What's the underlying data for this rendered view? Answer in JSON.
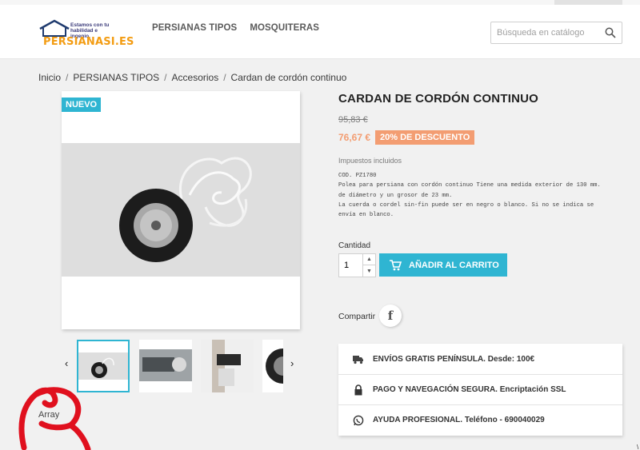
{
  "header": {
    "logo_tagline": "Estamos con tu habilidad e ingenio.",
    "logo_brand": "PERSIANASI.ES",
    "nav": [
      "PERSIANAS TIPOS",
      "MOSQUITERAS"
    ],
    "search_placeholder": "Búsqueda en catálogo"
  },
  "breadcrumb": [
    "Inicio",
    "PERSIANAS TIPOS",
    "Accesorios",
    "Cardan de cordón continuo"
  ],
  "product": {
    "badge": "NUEVO",
    "title": "CARDAN DE CORDÓN CONTINUO",
    "old_price": "95,83 €",
    "price": "76,67 €",
    "discount": "20% DE DESCUENTO",
    "taxes": "Impuestos incluidos",
    "description": [
      "COD. PZ1780",
      "Polea para persiana con cordón continuo Tiene una medida exterior de 130 mm.",
      "de diámetro y un grosor de 23 mm.",
      "La cuerda o cordel sin-fin puede ser en negro o blanco. Si no se indica se",
      "envía en blanco."
    ],
    "quantity_label": "Cantidad",
    "quantity_value": "1",
    "add_to_cart": "AÑADIR AL CARRITO",
    "share_label": "Compartir",
    "share_icon": "f"
  },
  "reassurance": [
    {
      "icon": "truck-icon",
      "text": "ENVÍOS GRATIS PENÍNSULA. Desde: 100€"
    },
    {
      "icon": "lock-icon",
      "text": "PAGO Y NAVEGACIÓN SEGURA. Encriptación SSL"
    },
    {
      "icon": "whatsapp-icon",
      "text": "AYUDA PROFESIONAL. Teléfono - 690040029"
    }
  ],
  "misc": {
    "array_text": "Array",
    "corner_mark": "\\",
    "arrow_left": "‹",
    "arrow_right": "›"
  },
  "colors": {
    "accent": "#2fb5d2",
    "discount": "#f39d72",
    "scribble": "#e0101e"
  }
}
